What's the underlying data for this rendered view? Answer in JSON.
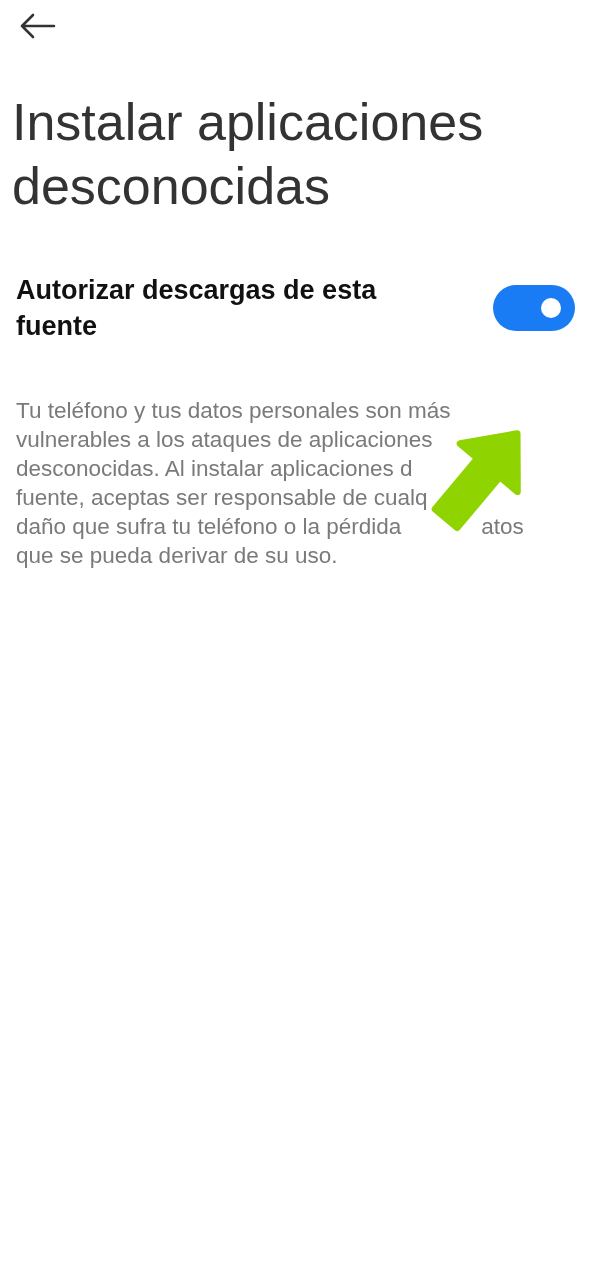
{
  "title": "Instalar aplicaciones desconocidas",
  "setting": {
    "label": "Autorizar descargas de esta fuente",
    "on": true
  },
  "description_lines": [
    {
      "parts": [
        "Tu teléfono y tus datos personales son más"
      ]
    },
    {
      "parts": [
        "vulnerables a los ataques de aplicaciones"
      ]
    },
    {
      "parts": [
        "desconocidas. Al instalar aplicaciones d"
      ]
    },
    {
      "parts": [
        "fuente, aceptas ser responsable de cualq"
      ]
    },
    {
      "parts": [
        "daño que sufra tu teléfono o la pérdida",
        "atos"
      ]
    },
    {
      "parts": [
        "que se pueda derivar de su uso."
      ]
    }
  ],
  "annotation": {
    "kind": "arrow"
  }
}
